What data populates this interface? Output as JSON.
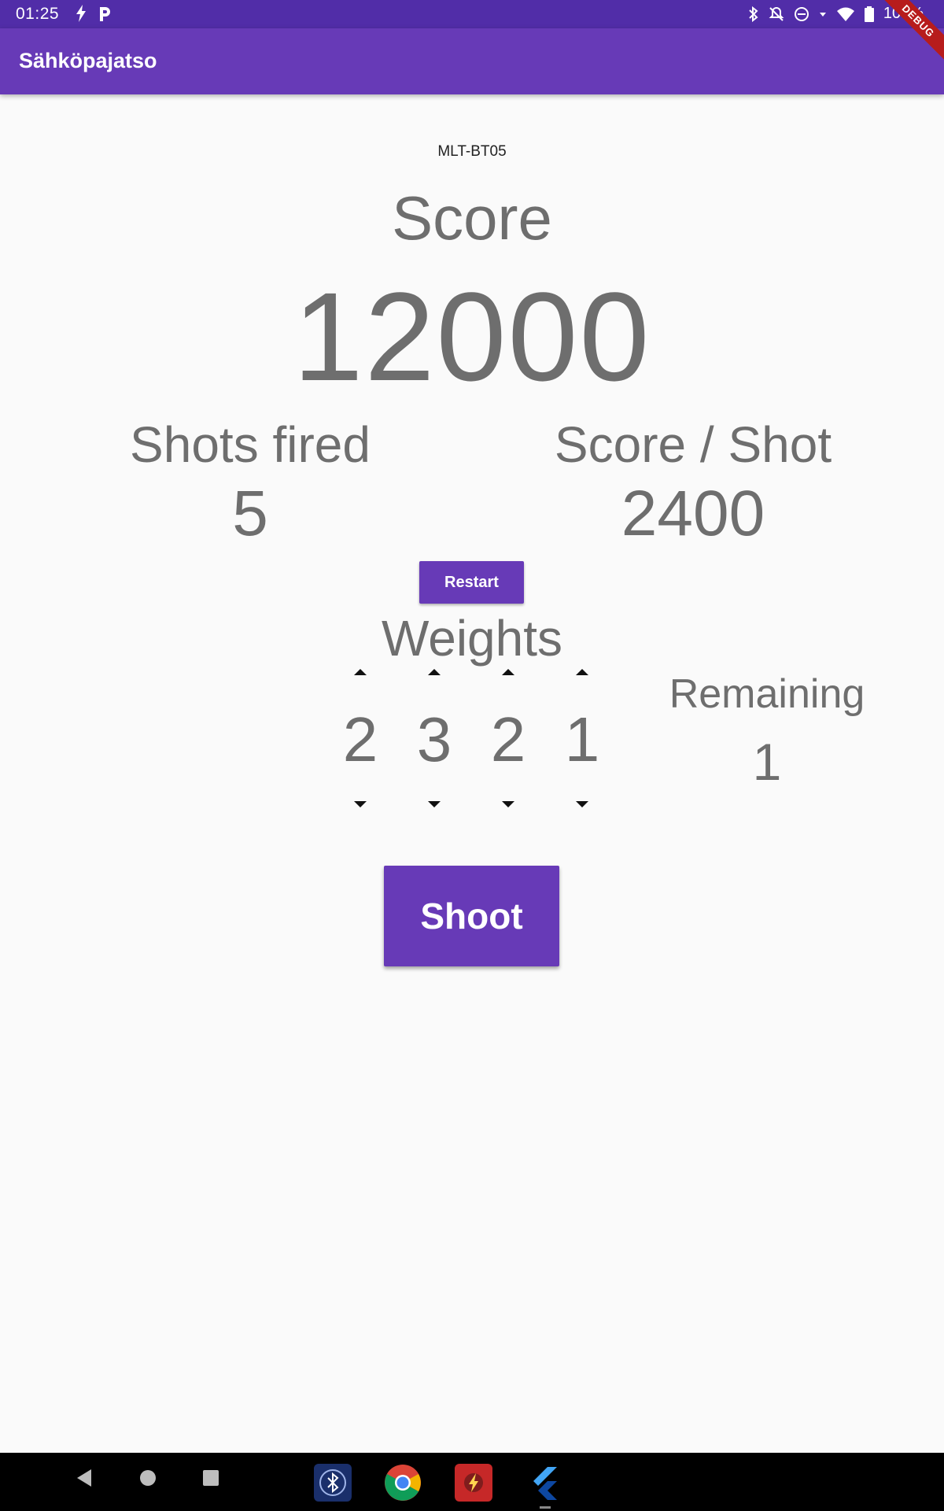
{
  "status_bar": {
    "time": "01:25",
    "left_icons": [
      "flash-icon",
      "p-icon"
    ],
    "right_icons": [
      "bluetooth-icon",
      "notifications-off-icon",
      "do-not-disturb-icon",
      "signal-dropdown-icon",
      "wifi-icon",
      "battery-icon"
    ],
    "battery": "100%"
  },
  "app_bar": {
    "title": "Sähköpajatso",
    "debug_banner": "DEBUG"
  },
  "device": {
    "name": "MLT-BT05"
  },
  "score": {
    "label": "Score",
    "value": "12000"
  },
  "stats": {
    "shots_fired_label": "Shots fired",
    "shots_fired_value": "5",
    "score_per_shot_label": "Score / Shot",
    "score_per_shot_value": "2400"
  },
  "restart_label": "Restart",
  "weights": {
    "label": "Weights",
    "values": [
      "2",
      "3",
      "2",
      "1"
    ],
    "remaining_label": "Remaining",
    "remaining_value": "1"
  },
  "shoot_label": "Shoot",
  "nav_bar": {
    "buttons": [
      "back-icon",
      "home-icon",
      "recents-icon"
    ],
    "apps": [
      "bluetooth-app-icon",
      "chrome-app-icon",
      "flash-app-icon",
      "flutter-app-icon"
    ]
  },
  "colors": {
    "primary": "#673ab7",
    "primary_dark": "#512da8",
    "text_grey": "#6e6e6e",
    "background": "#fafafa"
  }
}
